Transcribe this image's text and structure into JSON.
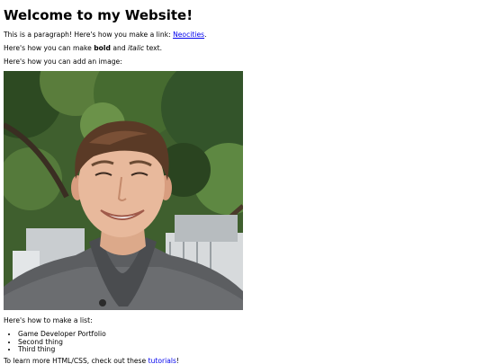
{
  "page": {
    "heading": "Welcome to my Website!",
    "para_link_prefix": "This is a paragraph! Here's how you make a link: ",
    "link_text": "Neocities",
    "para_link_suffix": ".",
    "bold_prefix": "Here's how you can make ",
    "bold_word": "bold",
    "bold_middle": " and ",
    "italic_word": "italic",
    "bold_suffix": " text.",
    "image_intro": "Here's how you can add an image:",
    "list_intro": "Here's how to make a list:",
    "list_items": [
      "Game Developer Portfolio",
      "Second thing",
      "Third thing"
    ],
    "footer_prefix": "To learn more HTML/CSS, check out these ",
    "footer_link": "tutorials",
    "footer_suffix": "!"
  },
  "colors": {
    "link": "#0000ee",
    "text": "#000000",
    "background": "#ffffff"
  }
}
